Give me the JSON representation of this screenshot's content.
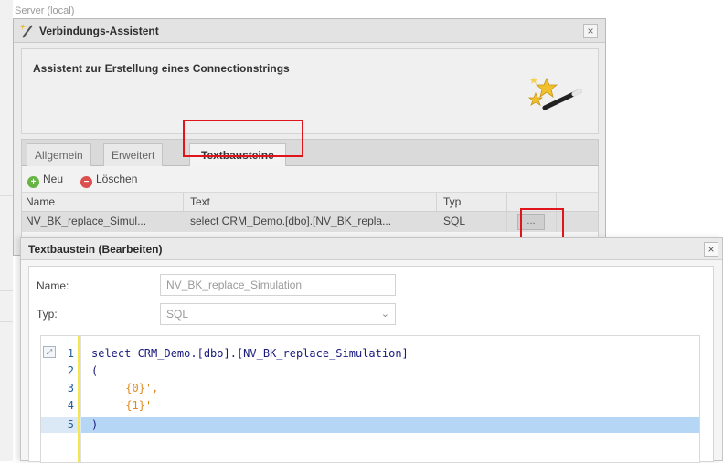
{
  "background": {
    "fragments": [
      "Server (local)"
    ]
  },
  "wizard": {
    "title": "Verbindungs-Assistent",
    "close_glyph": "×",
    "heading": "Assistent zur Erstellung eines Connectionstrings",
    "tabs": [
      {
        "label": "Allgemein",
        "active": false
      },
      {
        "label": "Erweitert",
        "active": false
      },
      {
        "label": "Textbausteine",
        "active": true
      }
    ],
    "toolbar": {
      "new_label": "Neu",
      "delete_label": "Löschen"
    },
    "grid": {
      "columns": [
        "Name",
        "Text",
        "Typ"
      ],
      "rows": [
        {
          "name": "NV_BK_replace_Simul...",
          "text": "select CRM_Demo.[dbo].[NV_BK_repla...",
          "typ": "SQL",
          "button": "..."
        },
        {
          "name": "",
          "text": "select CRM_Demo.[dbo].[NV_BK_repla...",
          "typ": "SQL",
          "button": ""
        }
      ]
    }
  },
  "dialog": {
    "title": "Textbaustein (Bearbeiten)",
    "close_glyph": "×",
    "fields": {
      "name_label": "Name:",
      "name_value": "NV_BK_replace_Simulation",
      "typ_label": "Typ:",
      "typ_value": "SQL"
    },
    "editor": {
      "lines": [
        {
          "no": "1",
          "code": "select CRM_Demo.[dbo].[NV_BK_replace_Simulation]"
        },
        {
          "no": "2",
          "code": "("
        },
        {
          "no": "3",
          "code": "'{0}',"
        },
        {
          "no": "4",
          "code": "'{1}'"
        },
        {
          "no": "5",
          "code": ")"
        }
      ],
      "highlighted_line": 5
    }
  },
  "colors": {
    "highlight_box": "#e0151c",
    "code_keyword": "#1a1a7e",
    "code_string": "#e08a1e",
    "active_line": "#b6d6f5"
  }
}
